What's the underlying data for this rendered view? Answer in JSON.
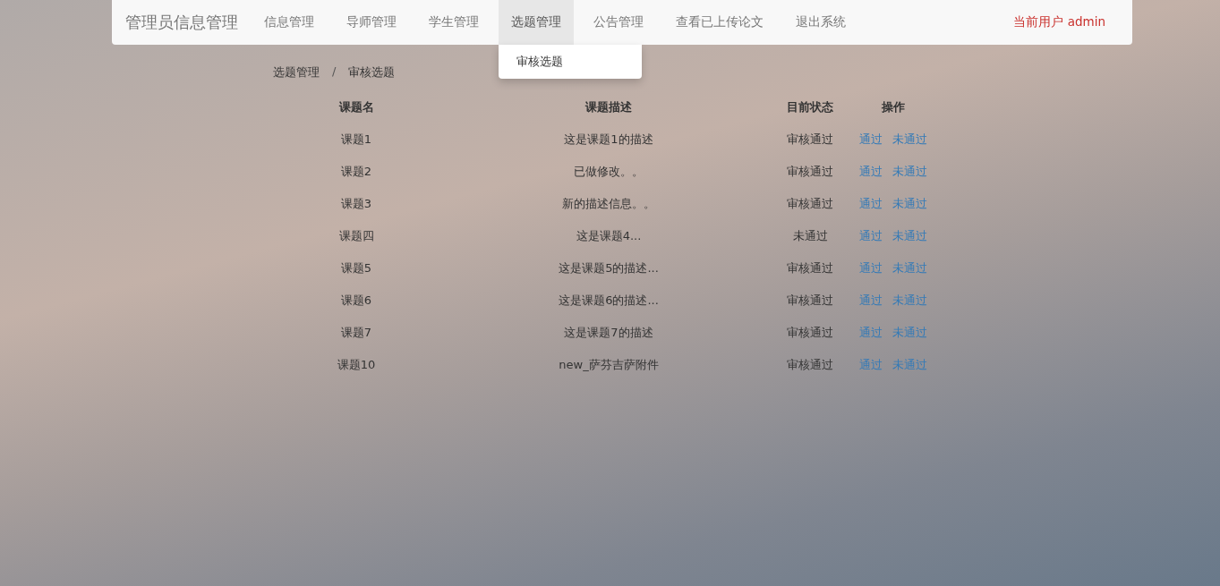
{
  "navbar": {
    "brand": "管理员信息管理",
    "items": [
      {
        "label": "信息管理",
        "selected": false
      },
      {
        "label": "导师管理",
        "selected": false
      },
      {
        "label": "学生管理",
        "selected": false
      },
      {
        "label": "选题管理",
        "selected": true,
        "dropdown": [
          "审核选题"
        ]
      },
      {
        "label": "公告管理",
        "selected": false
      },
      {
        "label": "查看已上传论文",
        "selected": false
      },
      {
        "label": "退出系统",
        "selected": false
      }
    ],
    "user": "当前用户 admin"
  },
  "breadcrumb": [
    "选题管理",
    "审核选题"
  ],
  "breadcrumb_separator": "/",
  "table": {
    "columns": [
      "课题名",
      "课题描述",
      "目前状态",
      "操作"
    ],
    "rows": [
      {
        "name": "课题1",
        "description": "这是课题1的描述",
        "status": "审核通过",
        "actions": [
          "通过",
          "未通过"
        ]
      },
      {
        "name": "课题2",
        "description": "已做修改。。",
        "status": "审核通过",
        "actions": [
          "通过",
          "未通过"
        ]
      },
      {
        "name": "课题3",
        "description": "新的描述信息。。",
        "status": "审核通过",
        "actions": [
          "通过",
          "未通过"
        ]
      },
      {
        "name": "课题四",
        "description": "这是课题4...",
        "status": "未通过",
        "actions": [
          "通过",
          "未通过"
        ]
      },
      {
        "name": "课题5",
        "description": "这是课题5的描述...",
        "status": "审核通过",
        "actions": [
          "通过",
          "未通过"
        ]
      },
      {
        "name": "课题6",
        "description": "这是课题6的描述...",
        "status": "审核通过",
        "actions": [
          "通过",
          "未通过"
        ]
      },
      {
        "name": "课题7",
        "description": "这是课题7的描述",
        "status": "审核通过",
        "actions": [
          "通过",
          "未通过"
        ]
      },
      {
        "name": "课题10",
        "description": "new_萨芬吉萨附件",
        "status": "审核通过",
        "actions": [
          "通过",
          "未通过"
        ]
      }
    ]
  }
}
